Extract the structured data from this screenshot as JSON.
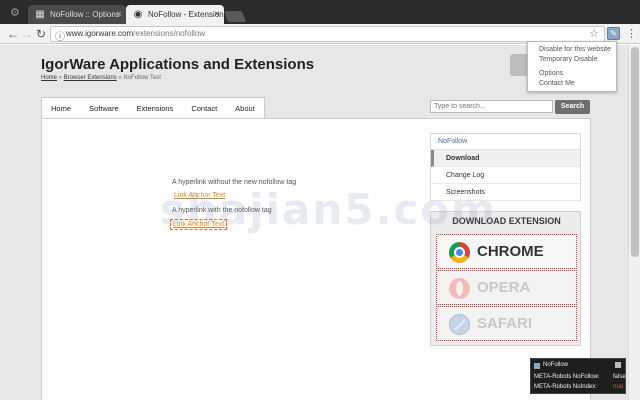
{
  "browser": {
    "tabs": [
      {
        "title": "NoFollow :: Options",
        "icon": "puzzle-icon",
        "active": false
      },
      {
        "title": "NoFollow - Extension for",
        "icon": "globe-icon",
        "active": true
      }
    ],
    "url_host": "www.igorware.com",
    "url_path": "/extensions/nofollow"
  },
  "popup_menu": {
    "items": [
      "Disable for this website",
      "Temporary Disable",
      "Options",
      "Contact Me"
    ]
  },
  "site": {
    "title": "IgorWare Applications and Extensions",
    "breadcrumb": [
      "Home",
      "Browser Extensions",
      "NoFollow Test"
    ],
    "nav": [
      "Home",
      "Software",
      "Extensions",
      "Contact",
      "About"
    ],
    "search_placeholder": "Type to search...",
    "search_button": "Search"
  },
  "content": {
    "text1": "A hyperlink without the new nofollow tag",
    "link1": "Link Anchor Text",
    "text2": "A hyperlink with the nofollow tag",
    "link2": "Link Anchor Text"
  },
  "sidebar": {
    "heading": "NoFollow",
    "items": [
      "Download",
      "Change Log",
      "Screenshots"
    ]
  },
  "download": {
    "title": "DOWNLOAD EXTENSION",
    "buttons": [
      "CHROME",
      "OPERA",
      "SAFARI"
    ]
  },
  "notification": {
    "title": "NoFollow",
    "rows": [
      {
        "label": "META-Robots NoFollow:",
        "value": "false"
      },
      {
        "label": "META-Robots NoIndex:",
        "value": "true"
      }
    ]
  },
  "watermark": "shajian5.com",
  "colors": {
    "accent": "#3a6ea5",
    "link": "#d48a2c",
    "dl_border": "#e04040"
  }
}
